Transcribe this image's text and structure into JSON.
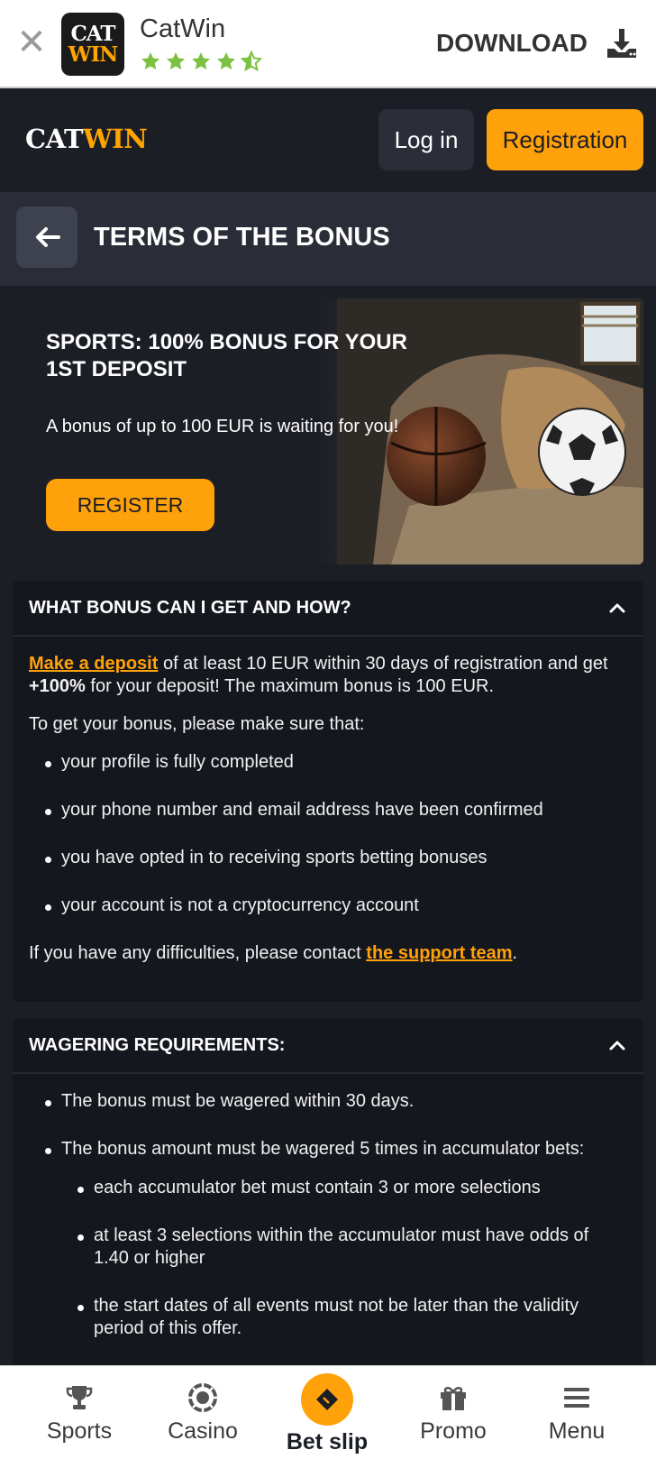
{
  "app_banner": {
    "app_name": "CatWin",
    "icon_line1": "CAT",
    "icon_line2": "WIN",
    "rating": 4.5,
    "download_label": "DOWNLOAD"
  },
  "header": {
    "logo_part1": "CAT",
    "logo_part2": "WIN",
    "login_label": "Log in",
    "register_label": "Registration"
  },
  "page": {
    "title": "TERMS OF THE BONUS"
  },
  "promo": {
    "title": "SPORTS: 100% BONUS FOR YOUR 1ST DEPOSIT",
    "subtitle": "A bonus of up to 100 EUR is waiting for you!",
    "button_label": "REGISTER"
  },
  "section1": {
    "title": "WHAT BONUS CAN I GET AND HOW?",
    "intro_link": "Make a deposit",
    "intro_text1": " of at least 10 EUR within 30 days of registration and get ",
    "intro_bold": "+100%",
    "intro_text2": " for your deposit! The maximum bonus is 100 EUR.",
    "conditions_lead": "To get your bonus, please make sure that:",
    "conditions": [
      "your profile is fully completed",
      "your phone number and email address have been confirmed",
      "you have opted in to receiving sports betting bonuses",
      "your account is not a cryptocurrency account"
    ],
    "support_text": "If you have any difficulties, please contact ",
    "support_link": "the support team",
    "support_end": "."
  },
  "section2": {
    "title": "WAGERING REQUIREMENTS:",
    "items": [
      "The bonus must be wagered within 30 days.",
      "The bonus amount must be wagered 5 times in accumulator bets:"
    ],
    "sub_items": [
      "each accumulator bet must contain 3 or more selections",
      "at least 3 selections within the accumulator must have odds of 1.40 or higher",
      "the start dates of all events must not be later than the validity period of this offer."
    ]
  },
  "bottom_nav": {
    "sports": "Sports",
    "casino": "Casino",
    "bet_slip": "Bet slip",
    "promo": "Promo",
    "menu": "Menu"
  },
  "colors": {
    "accent": "#ffa10a",
    "background": "#1c1e26",
    "star": "#7cc242"
  }
}
